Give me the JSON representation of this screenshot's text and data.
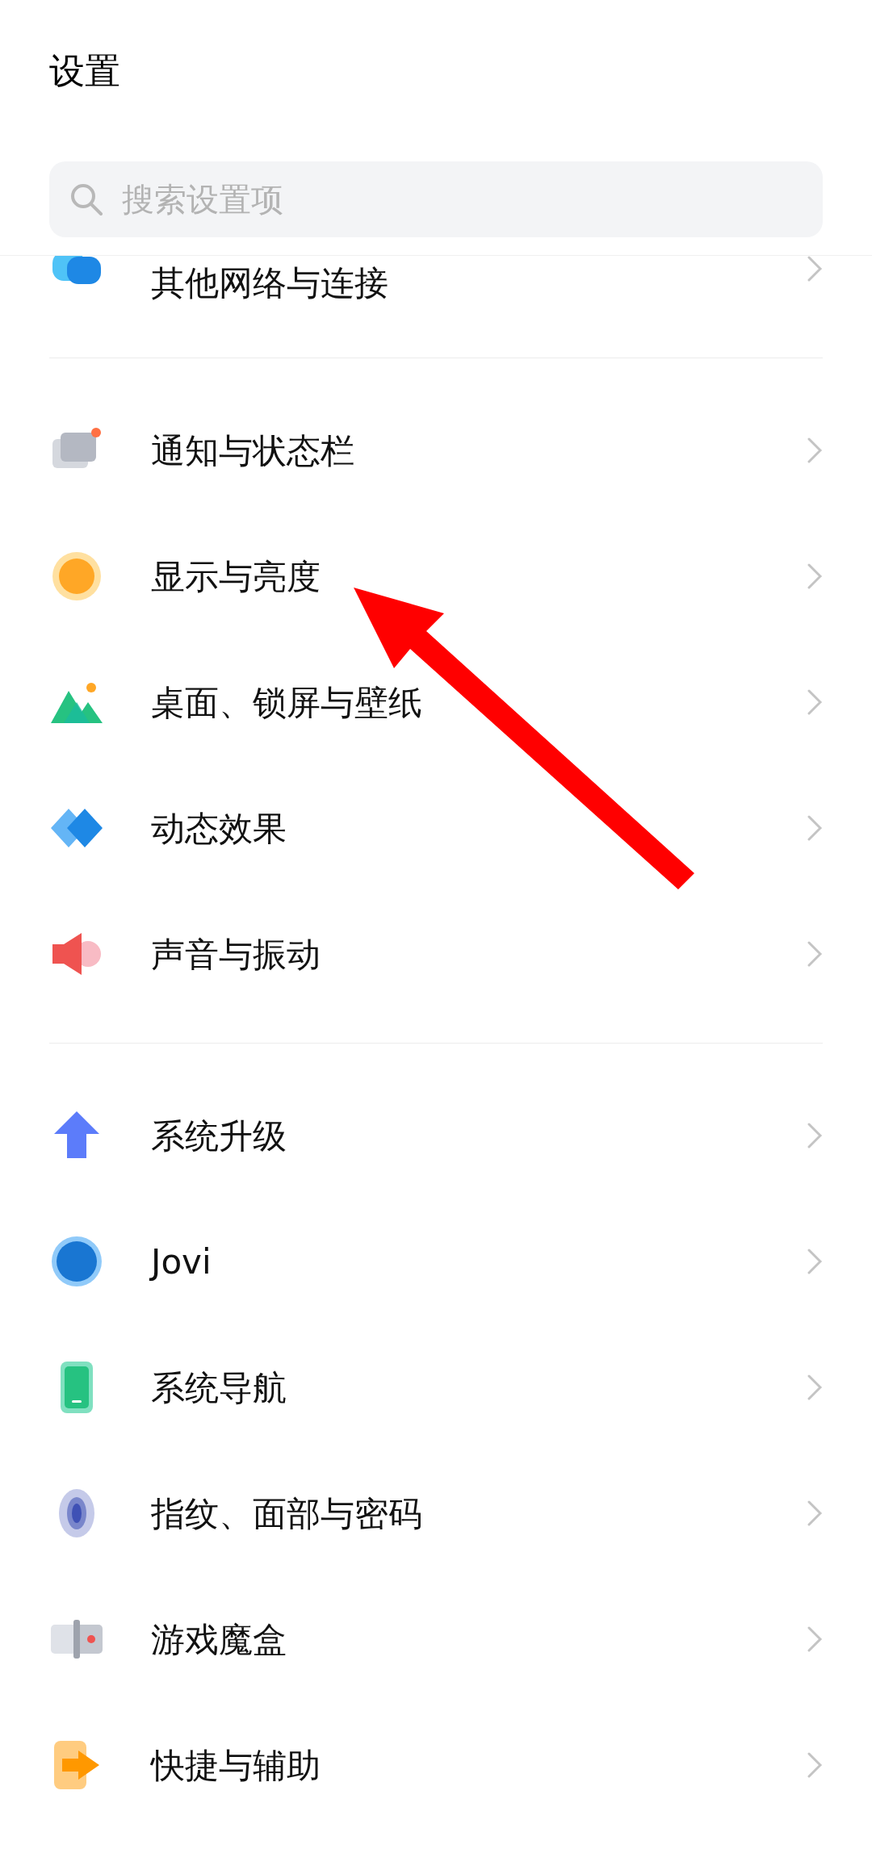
{
  "title": "设置",
  "search": {
    "placeholder": "搜索设置项"
  },
  "groups": [
    {
      "items": [
        {
          "kind": "network",
          "label": "其他网络与连接"
        }
      ]
    },
    {
      "items": [
        {
          "kind": "notification",
          "label": "通知与状态栏"
        },
        {
          "kind": "display",
          "label": "显示与亮度"
        },
        {
          "kind": "desktop",
          "label": "桌面、锁屏与壁纸"
        },
        {
          "kind": "animation",
          "label": "动态效果"
        },
        {
          "kind": "sound",
          "label": "声音与振动"
        }
      ]
    },
    {
      "items": [
        {
          "kind": "upgrade",
          "label": "系统升级"
        },
        {
          "kind": "jovi",
          "label": "Jovi"
        },
        {
          "kind": "navigation",
          "label": "系统导航"
        },
        {
          "kind": "fingerprint",
          "label": "指纹、面部与密码"
        },
        {
          "kind": "game",
          "label": "游戏魔盒"
        },
        {
          "kind": "shortcut",
          "label": "快捷与辅助"
        }
      ]
    }
  ]
}
